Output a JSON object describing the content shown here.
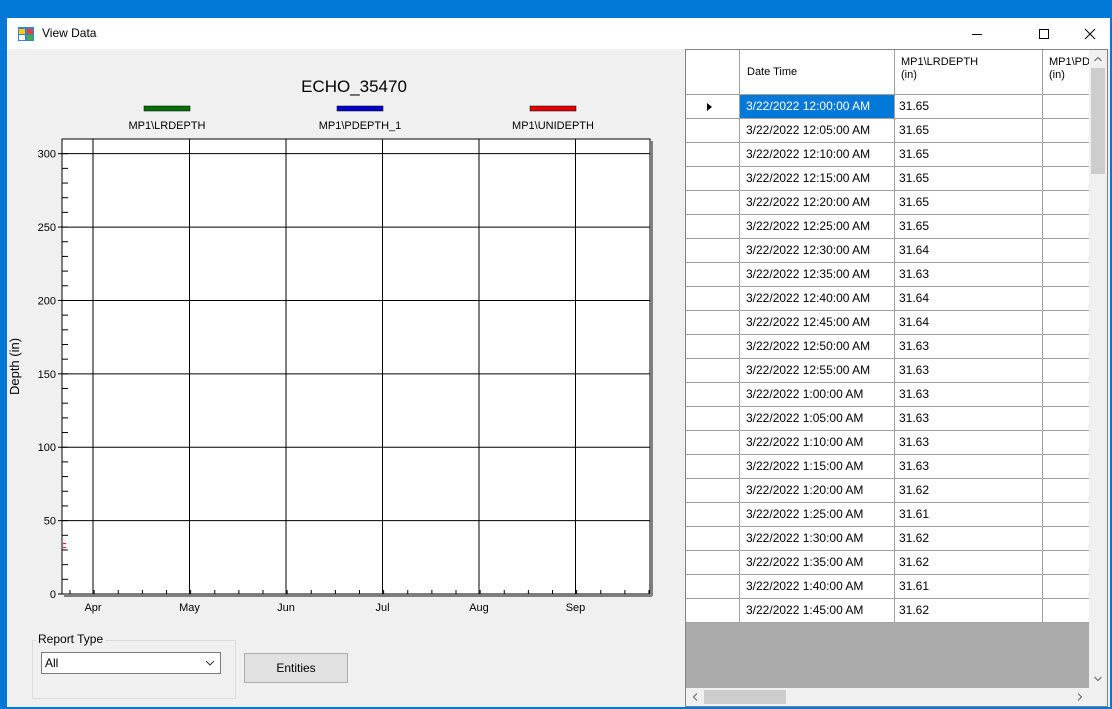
{
  "window": {
    "title": "View Data",
    "icon": "app-icon",
    "controls": [
      "minimize-icon",
      "maximize-icon",
      "close-icon"
    ]
  },
  "chart_data": {
    "type": "line",
    "title": "ECHO_35470",
    "ylabel": "Depth (in)",
    "xlabel": "",
    "x_ticks": [
      "Apr",
      "May",
      "Jun",
      "Jul",
      "Aug",
      "Sep"
    ],
    "y_ticks": [
      0,
      50,
      100,
      150,
      200,
      250,
      300
    ],
    "ylim": [
      0,
      310
    ],
    "grid": true,
    "legend_position": "top",
    "series": [
      {
        "name": "MP1\\LRDEPTH",
        "color": "#007000",
        "values": []
      },
      {
        "name": "MP1\\PDEPTH_1",
        "color": "#0000c8",
        "values": []
      },
      {
        "name": "MP1\\UNIDEPTH",
        "color": "#e00000",
        "values": []
      }
    ]
  },
  "report": {
    "legend": "Report Type",
    "selected": "All"
  },
  "buttons": {
    "entities": "Entities"
  },
  "grid": {
    "headers": {
      "datetime": "Date Time",
      "col1_line1": "MP1\\LRDEPTH",
      "col1_line2": "(in)",
      "col2_line1": "MP1\\PD",
      "col2_line2": "(in)"
    },
    "rows": [
      {
        "dt": "3/22/2022 12:00:00 AM",
        "v1": "31.65",
        "v2": ""
      },
      {
        "dt": "3/22/2022 12:05:00 AM",
        "v1": "31.65",
        "v2": ""
      },
      {
        "dt": "3/22/2022 12:10:00 AM",
        "v1": "31.65",
        "v2": ""
      },
      {
        "dt": "3/22/2022 12:15:00 AM",
        "v1": "31.65",
        "v2": ""
      },
      {
        "dt": "3/22/2022 12:20:00 AM",
        "v1": "31.65",
        "v2": ""
      },
      {
        "dt": "3/22/2022 12:25:00 AM",
        "v1": "31.65",
        "v2": ""
      },
      {
        "dt": "3/22/2022 12:30:00 AM",
        "v1": "31.64",
        "v2": ""
      },
      {
        "dt": "3/22/2022 12:35:00 AM",
        "v1": "31.63",
        "v2": ""
      },
      {
        "dt": "3/22/2022 12:40:00 AM",
        "v1": "31.64",
        "v2": ""
      },
      {
        "dt": "3/22/2022 12:45:00 AM",
        "v1": "31.64",
        "v2": ""
      },
      {
        "dt": "3/22/2022 12:50:00 AM",
        "v1": "31.63",
        "v2": ""
      },
      {
        "dt": "3/22/2022 12:55:00 AM",
        "v1": "31.63",
        "v2": ""
      },
      {
        "dt": "3/22/2022 1:00:00 AM",
        "v1": "31.63",
        "v2": ""
      },
      {
        "dt": "3/22/2022 1:05:00 AM",
        "v1": "31.63",
        "v2": ""
      },
      {
        "dt": "3/22/2022 1:10:00 AM",
        "v1": "31.63",
        "v2": ""
      },
      {
        "dt": "3/22/2022 1:15:00 AM",
        "v1": "31.63",
        "v2": ""
      },
      {
        "dt": "3/22/2022 1:20:00 AM",
        "v1": "31.62",
        "v2": ""
      },
      {
        "dt": "3/22/2022 1:25:00 AM",
        "v1": "31.61",
        "v2": ""
      },
      {
        "dt": "3/22/2022 1:30:00 AM",
        "v1": "31.62",
        "v2": ""
      },
      {
        "dt": "3/22/2022 1:35:00 AM",
        "v1": "31.62",
        "v2": ""
      },
      {
        "dt": "3/22/2022 1:40:00 AM",
        "v1": "31.61",
        "v2": ""
      },
      {
        "dt": "3/22/2022 1:45:00 AM",
        "v1": "31.62",
        "v2": ""
      }
    ]
  },
  "colors": {
    "titlebar_border": "#0078d7",
    "selection": "#0078d7"
  }
}
